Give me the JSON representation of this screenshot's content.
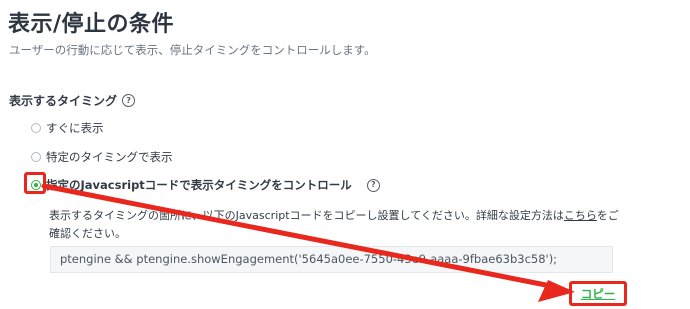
{
  "header": {
    "title": "表示/停止の条件",
    "description": "ユーザーの行動に応じて表示、停止タイミングをコントロールします。"
  },
  "timing": {
    "label": "表示するタイミング",
    "help_icon": "?",
    "options": [
      {
        "label": "すぐに表示",
        "selected": false
      },
      {
        "label": "特定のタイミングで表示",
        "selected": false
      },
      {
        "label": "指定のJavacsriptコードで表示タイミングをコントロール",
        "selected": true
      }
    ]
  },
  "instruction": {
    "text_before": "表示するタイミングの箇所に、以下のJavascriptコードをコピーし設置してください。詳細な設定方法は",
    "link": "こちら",
    "text_after": "をご確認ください。"
  },
  "code": {
    "value": "ptengine && ptengine.showEngagement('5645a0ee-7550-43e9-aaaa-9fbae63b3c58');"
  },
  "actions": {
    "copy_label": "コピー"
  },
  "colors": {
    "accent_green": "#2eb24b",
    "annotation_red": "#e8271d"
  },
  "icons": {
    "help": "help-circle-icon",
    "annotation": "red-arrow-icon"
  }
}
